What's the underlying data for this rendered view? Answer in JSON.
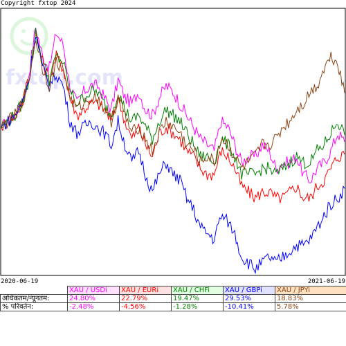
{
  "copyright": "Copyright fxtop 2024",
  "watermark": "fxtop.com",
  "chart_data": {
    "type": "line",
    "x_start": "2020-06-19",
    "x_end": "2021-06-19",
    "series": [
      {
        "name": "XAU / USDi",
        "color": "#ff00ff",
        "values": [
          0,
          1,
          2,
          4,
          9,
          17,
          12,
          10,
          16,
          14,
          7,
          4,
          6,
          7,
          7,
          5,
          3,
          8,
          5,
          4,
          6,
          3,
          2,
          5,
          7,
          6,
          4,
          2,
          0,
          -2,
          -3,
          -4,
          1,
          0,
          -3,
          -6,
          -5,
          -5,
          -3,
          -4,
          -7,
          -6,
          -6,
          -5,
          -8,
          -9,
          -7,
          -6,
          -4,
          -1,
          -2.5
        ]
      },
      {
        "name": "XAU / EURi",
        "color": "#ff0000",
        "values": [
          0,
          1,
          2,
          4,
          8,
          16,
          11,
          8,
          12,
          10,
          5,
          2,
          3,
          4,
          4,
          3,
          1,
          5,
          1,
          -2,
          0,
          -3,
          -5,
          -1,
          0,
          -1,
          -2,
          -4,
          -5,
          -7,
          -8,
          -8,
          -4,
          -5,
          -7,
          -10,
          -11,
          -12,
          -11,
          -11,
          -12,
          -12,
          -11,
          -10,
          -12,
          -12,
          -10,
          -9,
          -7,
          -5,
          -4.6
        ]
      },
      {
        "name": "XAU / CHFi",
        "color": "#008000",
        "values": [
          0,
          1,
          2,
          4,
          8,
          16,
          11,
          8,
          12,
          11,
          6,
          4,
          5,
          6,
          6,
          4,
          2,
          6,
          3,
          1,
          2,
          0,
          -2,
          1,
          3,
          2,
          1,
          -1,
          -3,
          -5,
          -5,
          -6,
          -2,
          -3,
          -5,
          -8,
          -8,
          -8,
          -7,
          -7,
          -8,
          -7,
          -6,
          -5,
          -6,
          -6,
          -4,
          -3,
          -1,
          1,
          -1.3
        ]
      },
      {
        "name": "XAU / GBPi",
        "color": "#0000ff",
        "values": [
          0,
          1,
          2,
          4,
          8,
          16,
          10,
          7,
          9,
          7,
          1,
          -1,
          0,
          1,
          0,
          -1,
          -3,
          1,
          -3,
          -6,
          -4,
          -8,
          -11,
          -8,
          -6,
          -8,
          -9,
          -12,
          -14,
          -17,
          -18,
          -19,
          -15,
          -16,
          -18,
          -22,
          -23,
          -24,
          -23,
          -22,
          -23,
          -22,
          -21,
          -20,
          -20,
          -19,
          -17,
          -15,
          -13,
          -12,
          -10.4
        ]
      },
      {
        "name": "XAU / JPYi",
        "color": "#8b4513",
        "values": [
          0,
          1,
          2,
          4,
          8,
          15,
          10,
          7,
          11,
          10,
          5,
          3,
          4,
          5,
          5,
          3,
          1,
          5,
          2,
          -1,
          0,
          -2,
          -4,
          -1,
          1,
          0,
          -1,
          -3,
          -4,
          -6,
          -5,
          -6,
          -2,
          -3,
          -5,
          -7,
          -6,
          -5,
          -3,
          -3,
          -2,
          0,
          1,
          3,
          4,
          6,
          7,
          10,
          12,
          11,
          5.8
        ]
      }
    ],
    "ylim": [
      -25,
      20
    ],
    "grid": false,
    "legend": "bottom-table"
  },
  "legend": {
    "headers": [
      "XAU / USDi",
      "XAU / EURi",
      "XAU / CHFi",
      "XAU / GBPi",
      "XAU / JPYi"
    ],
    "header_colors": [
      "#ff00ff",
      "#ff0000",
      "#008000",
      "#0000ff",
      "#8b4513"
    ],
    "header_backgrounds": [
      "#ffe0ff",
      "#ffe0e0",
      "#e0ffe0",
      "#e0e0ff",
      "#ffe0c0"
    ],
    "row1_label": "अधिकतम/न्यूनतम:",
    "row1_values": [
      "24.80%",
      "22.79%",
      "19.47%",
      "29.53%",
      "18.83%"
    ],
    "row2_label": "% परिवर्तन:",
    "row2_values": [
      "-2.48%",
      "-4.56%",
      "-1.28%",
      "-10.41%",
      "5.78%"
    ]
  }
}
